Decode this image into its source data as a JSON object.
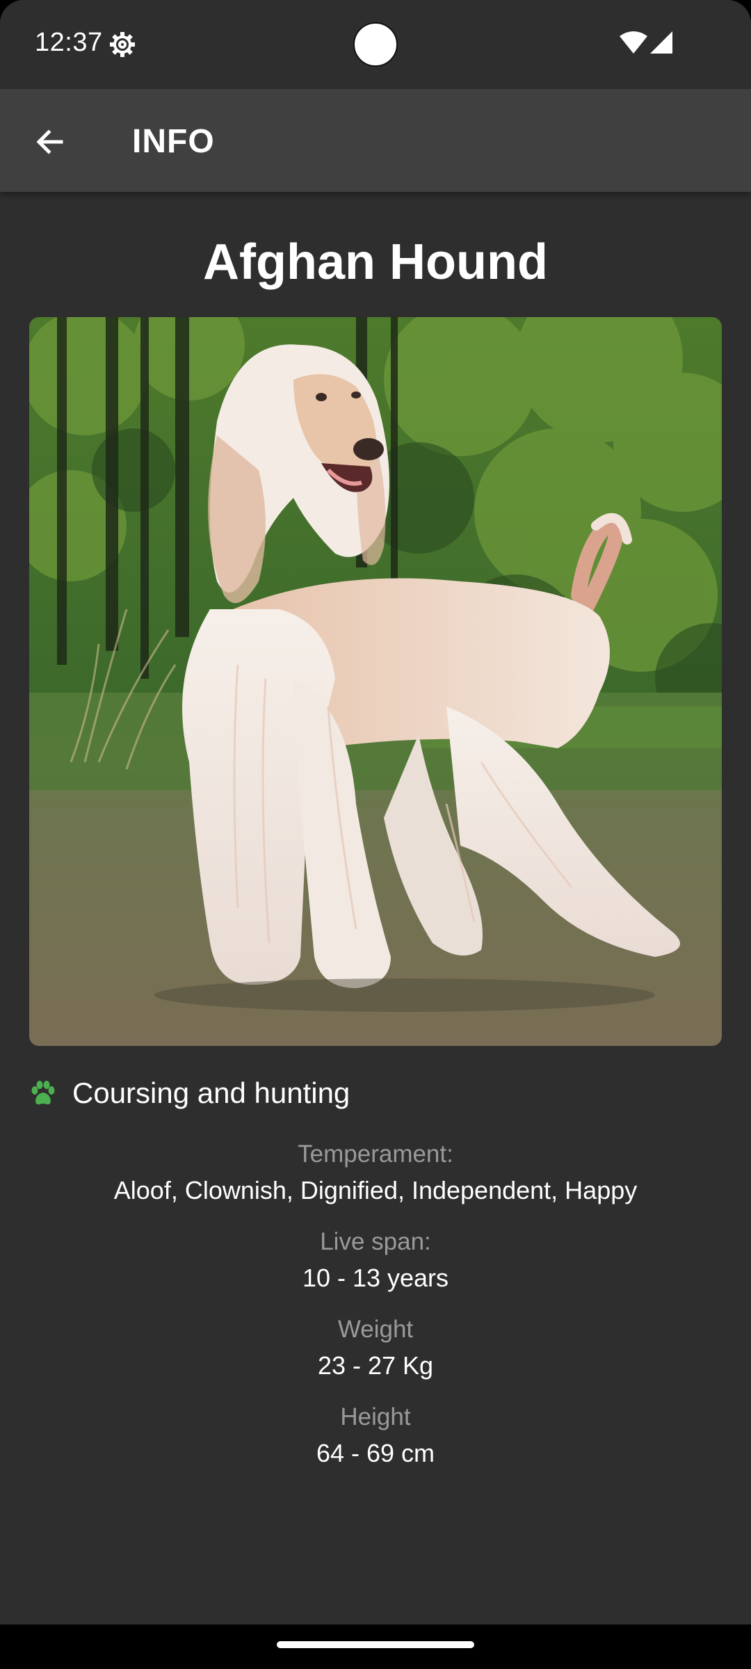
{
  "status_bar": {
    "time": "12:37",
    "icons": [
      "settings-gear-icon",
      "wifi-icon",
      "cell-signal-icon"
    ]
  },
  "app_bar": {
    "back_icon": "arrow-back-icon",
    "title": "INFO"
  },
  "breed": {
    "name": "Afghan Hound",
    "image": "afghan-hound-photo",
    "group_icon": "paw-icon",
    "group": "Coursing and hunting",
    "temperament_label": "Temperament:",
    "temperament": "Aloof, Clownish, Dignified, Independent, Happy",
    "lifespan_label": "Live span:",
    "lifespan": "10 - 13 years",
    "weight_label": "Weight",
    "weight": "23 - 27 Kg",
    "height_label": "Height",
    "height": "64 - 69 cm"
  },
  "colors": {
    "background": "#2e2e2e",
    "app_bar": "#404040",
    "accent_paw": "#4caf50",
    "label_gray": "#9a9a9a"
  }
}
